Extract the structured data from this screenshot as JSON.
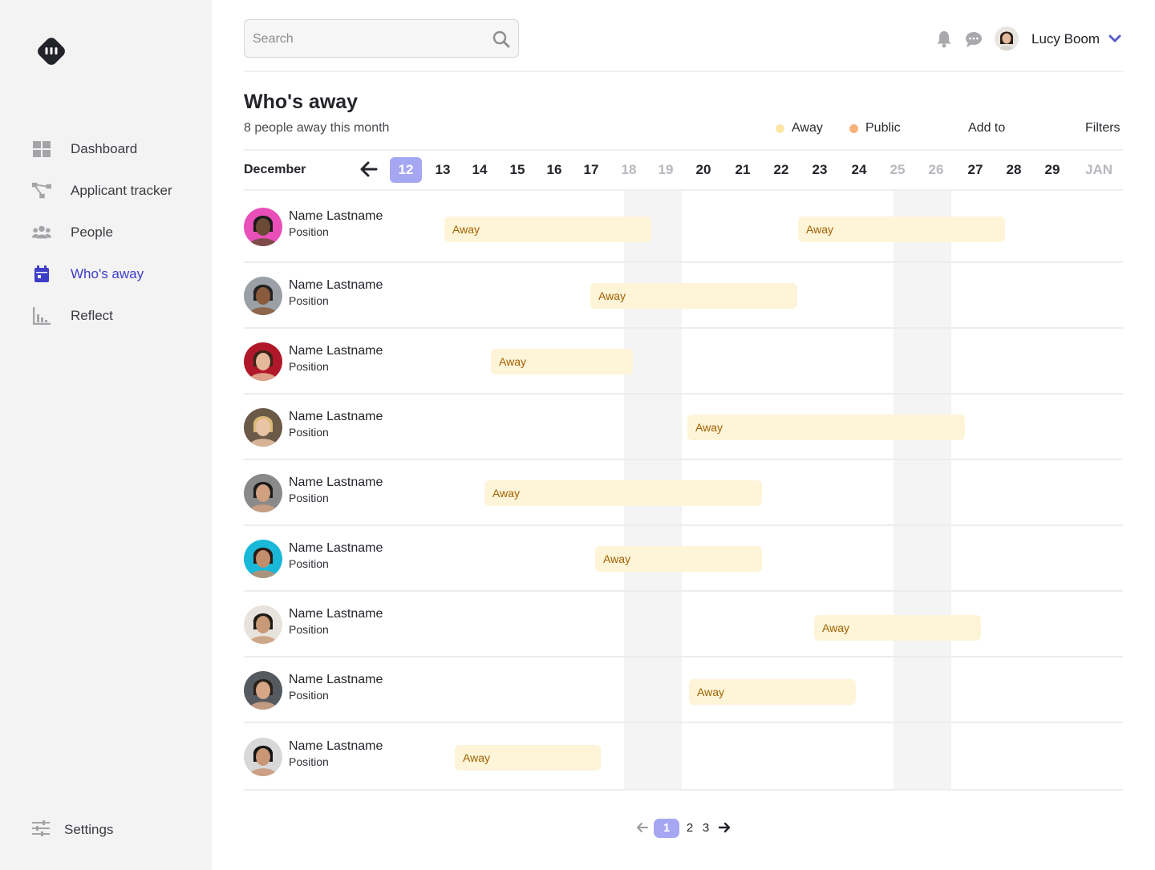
{
  "sidebar": {
    "items": [
      {
        "label": "Dashboard",
        "icon": "dashboard-icon"
      },
      {
        "label": "Applicant tracker",
        "icon": "tracker-icon"
      },
      {
        "label": "People",
        "icon": "people-icon"
      },
      {
        "label": "Who's away",
        "icon": "calendar-icon",
        "active": true
      },
      {
        "label": "Reflect",
        "icon": "chart-icon"
      }
    ],
    "settings_label": "Settings"
  },
  "header": {
    "search_placeholder": "Search",
    "user_name": "Lucy Boom"
  },
  "page": {
    "title": "Who's away",
    "subtitle": "8 people away this month",
    "legend": [
      {
        "label": "Away",
        "color": "#fde7a8"
      },
      {
        "label": "Public",
        "color": "#f7b27a"
      }
    ],
    "add_to_label": "Add to",
    "filters_label": "Filters"
  },
  "calendar": {
    "month_label": "December",
    "days": [
      {
        "label": "12",
        "state": "today"
      },
      {
        "label": "13",
        "state": "normal"
      },
      {
        "label": "14",
        "state": "normal"
      },
      {
        "label": "15",
        "state": "normal"
      },
      {
        "label": "16",
        "state": "normal"
      },
      {
        "label": "17",
        "state": "normal"
      },
      {
        "label": "18",
        "state": "weekend"
      },
      {
        "label": "19",
        "state": "weekend"
      },
      {
        "label": "20",
        "state": "normal"
      },
      {
        "label": "21",
        "state": "normal"
      },
      {
        "label": "22",
        "state": "normal"
      },
      {
        "label": "23",
        "state": "normal"
      },
      {
        "label": "24",
        "state": "normal"
      },
      {
        "label": "25",
        "state": "weekend"
      },
      {
        "label": "26",
        "state": "weekend"
      },
      {
        "label": "27",
        "state": "normal"
      },
      {
        "label": "28",
        "state": "normal"
      },
      {
        "label": "29",
        "state": "normal"
      },
      {
        "label": "JAN",
        "state": "weekend"
      }
    ]
  },
  "people": [
    {
      "name": "Name Lastname",
      "position": "Position",
      "skin": "#6b4a35",
      "bg": "#e84fb8",
      "hair": "#1a1a1a",
      "absences": [
        {
          "label": "Away"
        },
        {
          "label": "Away"
        }
      ]
    },
    {
      "name": "Name Lastname",
      "position": "Position",
      "skin": "#8a5a3c",
      "bg": "#9aa0a6",
      "hair": "#222222",
      "absences": [
        {
          "label": "Away"
        }
      ]
    },
    {
      "name": "Name Lastname",
      "position": "Position",
      "skin": "#e6b89a",
      "bg": "#b0182a",
      "hair": "#3b2418",
      "absences": [
        {
          "label": "Away"
        }
      ]
    },
    {
      "name": "Name Lastname",
      "position": "Position",
      "skin": "#eac4a6",
      "bg": "#6b5a48",
      "hair": "#d9b878",
      "absences": [
        {
          "label": "Away"
        }
      ]
    },
    {
      "name": "Name Lastname",
      "position": "Position",
      "skin": "#d0a080",
      "bg": "#8a8a8a",
      "hair": "#1c1c1c",
      "absences": [
        {
          "label": "Away"
        }
      ]
    },
    {
      "name": "Name Lastname",
      "position": "Position",
      "skin": "#c48e6c",
      "bg": "#1ab8d8",
      "hair": "#2a1a12",
      "absences": [
        {
          "label": "Away"
        }
      ]
    },
    {
      "name": "Name Lastname",
      "position": "Position",
      "skin": "#c89a78",
      "bg": "#e8e2dc",
      "hair": "#1e1a16",
      "absences": [
        {
          "label": "Away"
        }
      ]
    },
    {
      "name": "Name Lastname",
      "position": "Position",
      "skin": "#d6a686",
      "bg": "#555a60",
      "hair": "#2a2018",
      "absences": [
        {
          "label": "Away"
        }
      ]
    },
    {
      "name": "Name Lastname",
      "position": "Position",
      "skin": "#c99676",
      "bg": "#d8d8d8",
      "hair": "#141414",
      "absences": [
        {
          "label": "Away"
        }
      ]
    }
  ],
  "pagination": {
    "pages": [
      "1",
      "2",
      "3"
    ],
    "current": "1"
  }
}
